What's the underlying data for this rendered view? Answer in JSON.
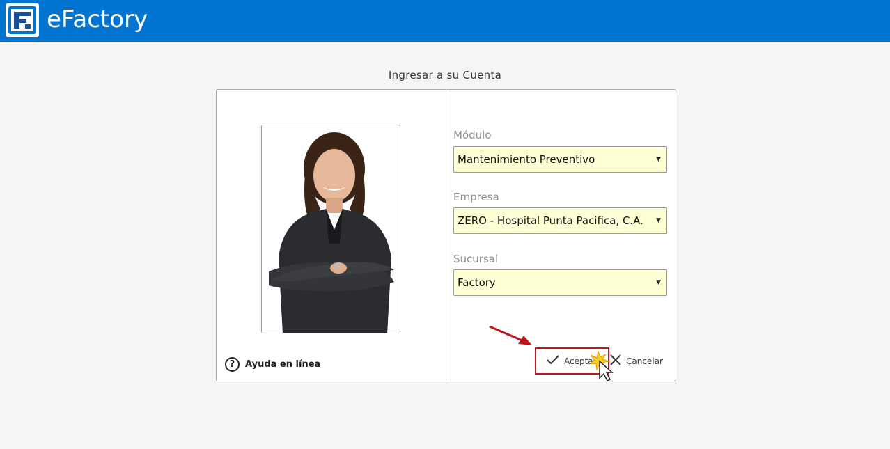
{
  "header": {
    "app_title": "eFactory",
    "logo_icon": "efactory-logo-icon",
    "bar_color": "#0074d0"
  },
  "login": {
    "title": "Ingresar a su Cuenta",
    "help_label": "Ayuda en línea",
    "help_icon": "?",
    "fields": [
      {
        "label": "Módulo",
        "value": "Mantenimiento Preventivo"
      },
      {
        "label": "Empresa",
        "value": "ZERO - Hospital Punta Pacifica, C.A."
      },
      {
        "label": "Sucursal",
        "value": "Factory"
      }
    ],
    "select_arrow": "▼",
    "accept_label": "Aceptar",
    "cancel_label": "Cancelar",
    "select_background": "#ffffd6"
  },
  "annotation": {
    "highlight_color": "#c0161b"
  }
}
